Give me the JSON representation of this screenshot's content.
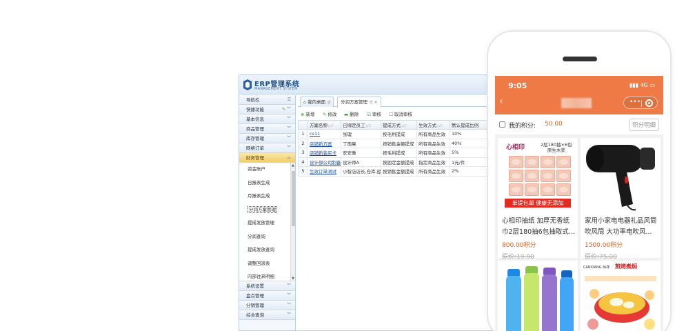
{
  "erp": {
    "title": "ERP管理系统",
    "subtitle": "MANAGEMENT SYSTEM",
    "sidebar": {
      "nav_label": "导航栏",
      "quick_label": "快捷功能",
      "groups_top": [
        "基本信息",
        "商品管理",
        "库存管理",
        "网络订单",
        "财务管理"
      ],
      "finance_items": [
        "资金账户",
        "日报表生成",
        "月报表生成",
        "分润方案管理",
        "提成发放管理",
        "分润查询",
        "提成发放查询",
        "调整回滚表",
        "内部往来明细"
      ],
      "groups_bottom": [
        "系统设置",
        "盘点管理",
        "分销管理",
        "综合查询"
      ]
    },
    "tabs": [
      {
        "label": "我的桌面",
        "close": "d"
      },
      {
        "label": "分润方案管理",
        "close": "d ×"
      }
    ],
    "toolbar": {
      "add": "新增",
      "edit": "修改",
      "delete": "删除",
      "audit": "审核",
      "cancel_audit": "取消审核"
    },
    "grid": {
      "columns": [
        "方案名称",
        "已绑定员工",
        "提成方式",
        "生效方式",
        "默认提成比例"
      ],
      "rows": [
        {
          "no": "1",
          "name": "cs11",
          "staff": "张理",
          "method": "按毛利提成",
          "effect": "所有商品生效",
          "ratio": "10%"
        },
        {
          "no": "2",
          "name": "店铺新方案",
          "staff": "丁雨果",
          "method": "按销售金额提成",
          "effect": "所有商品生效",
          "ratio": "40%"
        },
        {
          "no": "3",
          "name": "店铺新装买卡",
          "staff": "安安雅",
          "method": "按毛利提成",
          "effect": "所有商品生效",
          "ratio": "5%"
        },
        {
          "no": "4",
          "name": "设计部公司制备",
          "staff": "设计师A",
          "method": "按固定金额提成",
          "effect": "指定商品生效",
          "ratio": "1元/件"
        },
        {
          "no": "5",
          "name": "生效订单测试",
          "staff": "小智店店长,仓库,经",
          "method": "按销售金额提成",
          "effect": "所有商品生效",
          "ratio": "2%"
        }
      ]
    }
  },
  "phone": {
    "time": "9:05",
    "status": "4G",
    "points_label": "我的积分:",
    "points_value": "50.00",
    "points_detail": "积分明细",
    "products": [
      {
        "name": "心相印抽纸 加厚无香纸巾2层180抽6包抽取式...",
        "price": "800.00积分",
        "orig": "原价:19.90",
        "banner": "单提包邮 健康无添加",
        "tag": "2层180抽×6包 \n 原生木浆",
        "logo": "心相印"
      },
      {
        "name": "家用小家电电器礼品风筒吹风筒 大功率电吹风...",
        "price": "1500.00积分",
        "orig": "原价:75.00"
      },
      {
        "name": "",
        "price": "",
        "orig": ""
      },
      {
        "name": "",
        "price": "",
        "orig": "",
        "brand": "CANXIANG 灿祥",
        "title": "煎烤煮焖"
      }
    ]
  },
  "colors": {
    "phone_header": "#f07a45",
    "price": "#e0651c",
    "erp_accent": "#1f4f8a"
  }
}
